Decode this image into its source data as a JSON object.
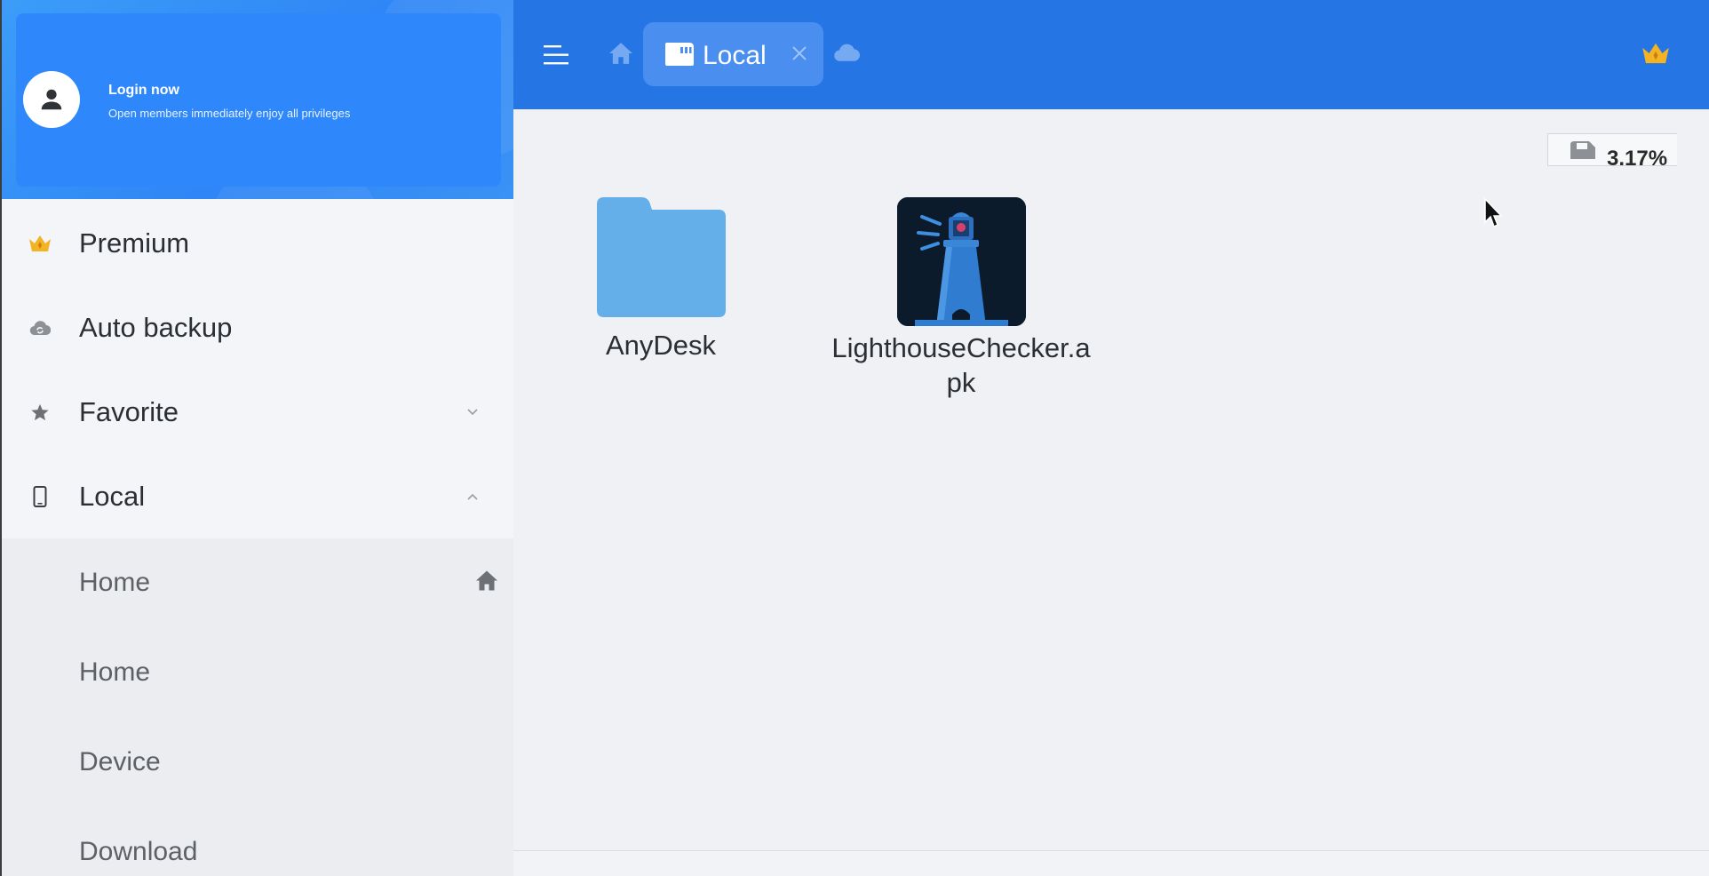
{
  "sidebar": {
    "login": {
      "title": "Login now",
      "subtitle": "Open members immediately enjoy all privileges"
    },
    "items": [
      {
        "label": "Premium",
        "icon": "crown-icon"
      },
      {
        "label": "Auto backup",
        "icon": "cloud-sync-icon"
      },
      {
        "label": "Favorite",
        "icon": "star-icon",
        "chevron": "down"
      },
      {
        "label": "Local",
        "icon": "phone-icon",
        "chevron": "up"
      }
    ],
    "local_children": [
      {
        "label": "Home",
        "icon": "home-icon"
      },
      {
        "label": "Home"
      },
      {
        "label": "Device"
      },
      {
        "label": "Download"
      }
    ]
  },
  "toolbar": {
    "active_tab_label": "Local"
  },
  "storage": {
    "percent": "3.17%"
  },
  "files": [
    {
      "name": "AnyDesk",
      "type": "folder"
    },
    {
      "name_line1": "LighthouseChecker.a",
      "name_line2": "pk",
      "type": "apk"
    }
  ],
  "colors": {
    "accent": "#2575e4",
    "sidebar_header": "#2f88fb",
    "folder": "#64aeea"
  }
}
